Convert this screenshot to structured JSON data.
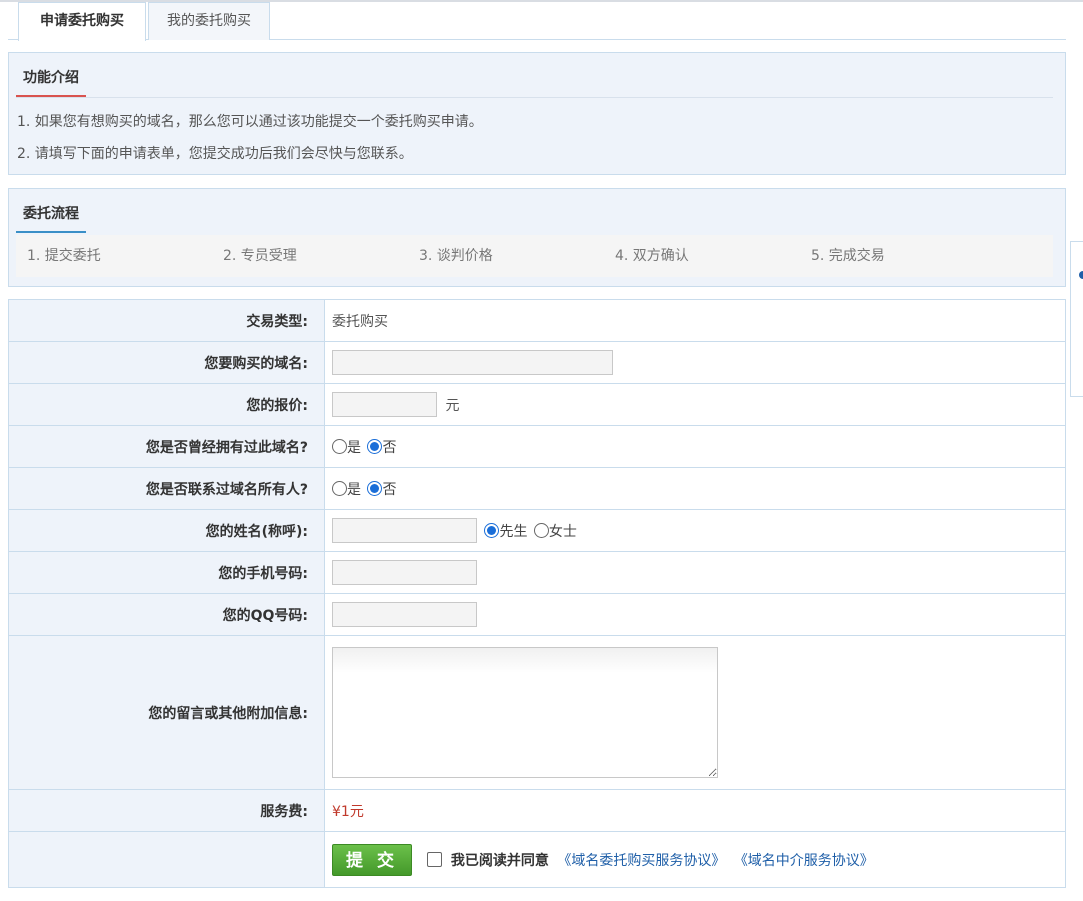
{
  "tabs": {
    "active": "申请委托购买",
    "inactive": "我的委托购买"
  },
  "intro": {
    "title": "功能介绍",
    "lines": [
      "1. 如果您有想购买的域名，那么您可以通过该功能提交一个委托购买申请。",
      "2. 请填写下面的申请表单，您提交成功后我们会尽快与您联系。"
    ]
  },
  "process": {
    "title": "委托流程",
    "steps": [
      "1. 提交委托",
      "2. 专员受理",
      "3. 谈判价格",
      "4. 双方确认",
      "5. 完成交易"
    ]
  },
  "form": {
    "trade_type": {
      "label": "交易类型:",
      "value": "委托购买"
    },
    "domain": {
      "label": "您要购买的域名:",
      "value": ""
    },
    "price": {
      "label": "您的报价:",
      "value": "",
      "unit": "元"
    },
    "owned_before": {
      "label": "您是否曾经拥有过此域名?",
      "yes": "是",
      "no": "否",
      "selected": "否"
    },
    "contacted_owner": {
      "label": "您是否联系过域名所有人?",
      "yes": "是",
      "no": "否",
      "selected": "否"
    },
    "name": {
      "label": "您的姓名(称呼):",
      "value": "",
      "male": "先生",
      "female": "女士",
      "selected": "先生"
    },
    "phone": {
      "label": "您的手机号码:",
      "value": ""
    },
    "qq": {
      "label": "您的QQ号码:",
      "value": ""
    },
    "message": {
      "label": "您的留言或其他附加信息:",
      "value": ""
    },
    "fee": {
      "label": "服务费:",
      "value": "¥1元"
    },
    "submit_label": "提 交",
    "agree_text": "我已阅读并同意",
    "agree_checked": false,
    "agreement1": "《域名委托购买服务协议》",
    "agreement2": "《域名中介服务协议》"
  },
  "colors": {
    "accent_blue": "#1f5fa8",
    "intro_underline": "#d9534f",
    "process_underline": "#3a8fc7",
    "submit_green": "#52a934",
    "fee_red": "#c0392b",
    "panel_bg": "#eef3fa"
  }
}
